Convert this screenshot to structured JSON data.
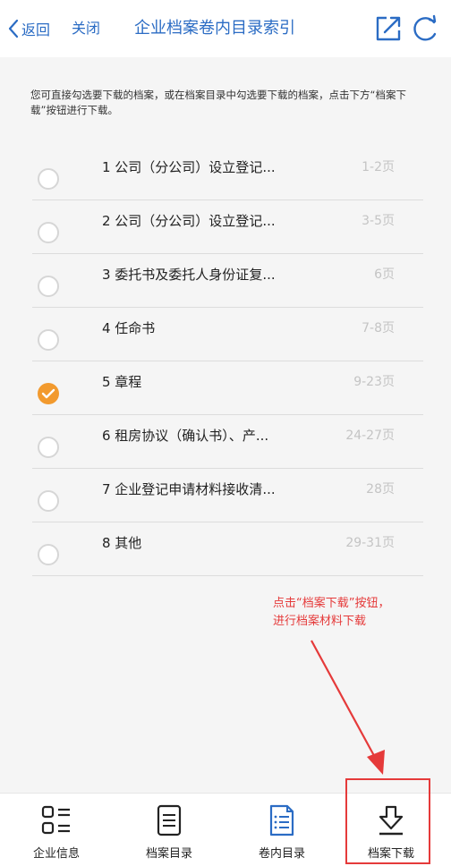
{
  "header": {
    "back_label": "返回",
    "close_label": "关闭",
    "title": "企业档案卷内目录索引",
    "accent_color": "#2b6cc4"
  },
  "notice": {
    "text": "您可直接勾选要下载的档案，或在档案目录中勾选要下载的档案，点击下方“档案下载”按钮进行下载。"
  },
  "items": [
    {
      "title": "1 公司（分公司）设立登记...",
      "pages": "1-2页",
      "checked": false
    },
    {
      "title": "2 公司（分公司）设立登记...",
      "pages": "3-5页",
      "checked": false
    },
    {
      "title": "3 委托书及委托人身份证复...",
      "pages": "6页",
      "checked": false
    },
    {
      "title": "4 任命书",
      "pages": "7-8页",
      "checked": false
    },
    {
      "title": "5 章程",
      "pages": "9-23页",
      "checked": true
    },
    {
      "title": "6 租房协议（确认书）、产...",
      "pages": "24-27页",
      "checked": false
    },
    {
      "title": "7 企业登记申请材料接收清...",
      "pages": "28页",
      "checked": false
    },
    {
      "title": "8 其他",
      "pages": "29-31页",
      "checked": false
    }
  ],
  "annotation": {
    "line1": "点击“档案下载”按钮，",
    "line2": "进行档案材料下载",
    "color": "#e53a3a"
  },
  "tabs": [
    {
      "label": "企业信息",
      "icon": "company-info-icon"
    },
    {
      "label": "档案目录",
      "icon": "archive-catalog-icon"
    },
    {
      "label": "卷内目录",
      "icon": "volume-catalog-icon"
    },
    {
      "label": "档案下载",
      "icon": "download-icon"
    }
  ],
  "checked_color": "#f29a2e"
}
